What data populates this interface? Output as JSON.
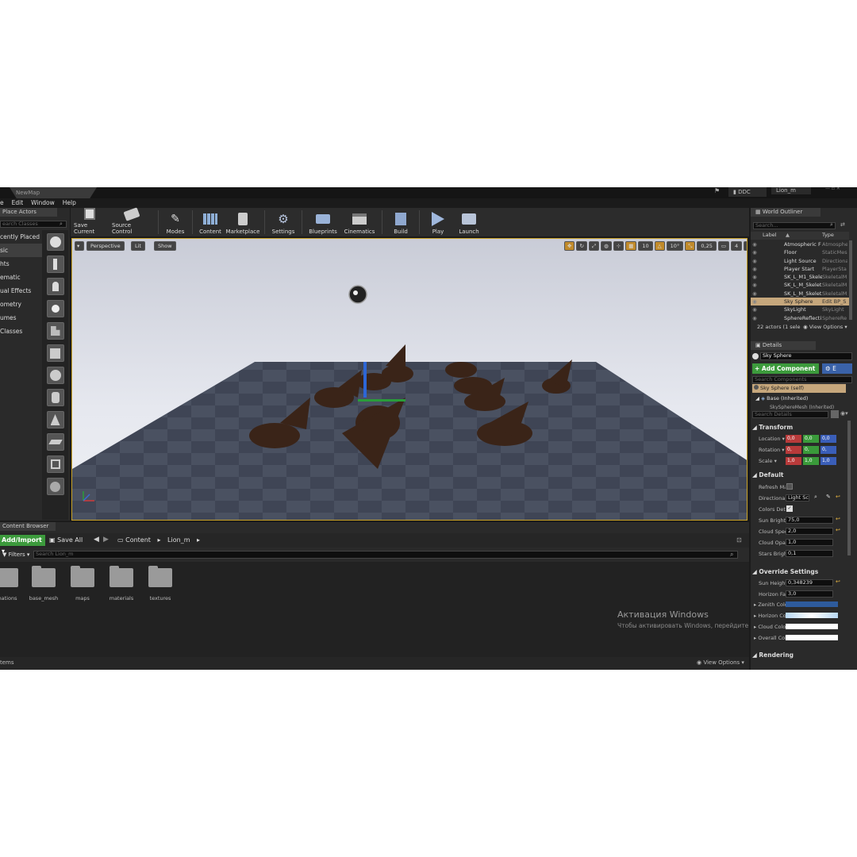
{
  "window": {
    "doc_tab": "NewMap",
    "ddc_label": "DDC",
    "project_label": "Lion_m"
  },
  "menu": [
    "e",
    "Edit",
    "Window",
    "Help"
  ],
  "place_actors": {
    "title": "Place Actors",
    "search_placeholder": "earch Classes",
    "categories": [
      "cently Placed",
      "sic",
      "hts",
      "ematic",
      "ual Effects",
      "ometry",
      "umes",
      "Classes"
    ]
  },
  "toolbar": {
    "buttons": [
      "Save Current",
      "Source Control",
      "Modes",
      "Content",
      "Marketplace",
      "Settings",
      "Blueprints",
      "Cinematics",
      "Build",
      "Play",
      "Launch"
    ]
  },
  "viewport": {
    "perspective": "Perspective",
    "lit": "Lit",
    "show": "Show",
    "grid_snap": "10",
    "rot_snap": "10°",
    "scale_snap": "0,25",
    "cam_speed": "4"
  },
  "world_outliner": {
    "title": "World Outliner",
    "search_placeholder": "Search...",
    "col_label": "Label",
    "col_type": "Type",
    "rows": [
      {
        "label": "Atmospheric F",
        "type": "Atmospheri"
      },
      {
        "label": "Floor",
        "type": "StaticMes"
      },
      {
        "label": "Light Source",
        "type": "Directiona"
      },
      {
        "label": "Player Start",
        "type": "PlayerSta"
      },
      {
        "label": "SK_L_M1_Skele",
        "type": "SkeletalM"
      },
      {
        "label": "SK_L_M_Skelet",
        "type": "SkeletalM"
      },
      {
        "label": "SK_L_M_Skelet",
        "type": "SkeletalM"
      },
      {
        "label": "Sky Sphere",
        "type": "Edit BP_S"
      },
      {
        "label": "SkyLight",
        "type": "SkyLight"
      },
      {
        "label": "SphereReflecti",
        "type": "SphereRe"
      }
    ],
    "count": "22 actors (1 sele",
    "view_options": "View Options"
  },
  "details": {
    "title": "Details",
    "name_value": "Sky Sphere",
    "add_component": "+ Add Component",
    "edit_bp": "E",
    "search_components_placeholder": "Search Components",
    "comp_self": "Sky Sphere (self)",
    "comp_base": "Base (Inherited)",
    "comp_mesh": "SkySphereMesh (Inherited)",
    "search_details_placeholder": "Search Details",
    "transform_title": "Transform",
    "location_label": "Location",
    "rotation_label": "Rotation",
    "scale_label": "Scale",
    "loc_vals": [
      "0,0",
      "0,0",
      "0,0"
    ],
    "rot_vals": [
      "0,",
      "0,",
      "0,"
    ],
    "scale_vals": [
      "1,0",
      "1,0",
      "1,0"
    ],
    "default_title": "Default",
    "refresh_label": "Refresh Ma",
    "directional_label": "Directional",
    "directional_value": "Light Sc",
    "colors_label": "Colors Dete",
    "sun_bright_label": "Sun Brightn",
    "sun_bright_value": "75,0",
    "cloud_speed_label": "Cloud Spee",
    "cloud_speed_value": "2,0",
    "cloud_opac_label": "Cloud Opac",
    "cloud_opac_value": "1,0",
    "stars_label": "Stars Brigh",
    "stars_value": "0,1",
    "override_title": "Override Settings",
    "sun_height_label": "Sun Height",
    "sun_height_value": "0,348239",
    "horizon_falloff_label": "Horizon Fal",
    "horizon_falloff_value": "3,0",
    "zenith_label": "Zenith Colo",
    "horizon_color_label": "Horizon Co",
    "cloud_color_label": "Cloud Color",
    "overall_label": "Overall Col",
    "rendering_title": "Rendering",
    "zenith_color": "#2e5b9c",
    "horizon_color": "#b8d8f2",
    "cloud_color": "#ffffff",
    "overall_color": "#ffffff"
  },
  "content_browser": {
    "title": "Content Browser",
    "add_import": "Add/Import",
    "save_all": "Save All",
    "path_root": "Content",
    "path_child": "Lion_m",
    "filters": "Filters",
    "search_placeholder": "Search Lion_m",
    "folders": [
      "imations",
      "base_mesh",
      "maps",
      "materials",
      "textures"
    ],
    "items_count": "tems",
    "view_options": "View Options"
  },
  "watermark": {
    "line1": "Активация Windows",
    "line2": "Чтобы активировать Windows, перейдите в раздел \"Параметры\"."
  }
}
